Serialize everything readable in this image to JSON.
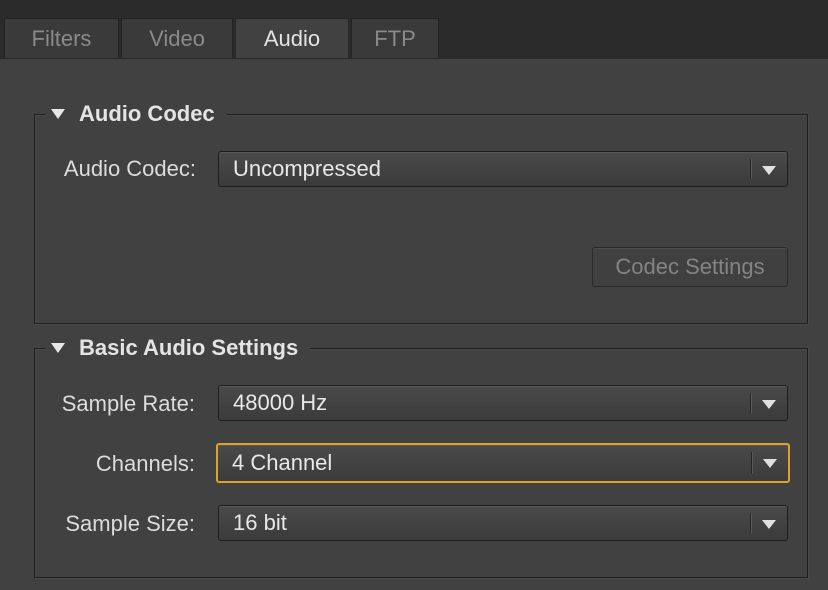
{
  "tabs": [
    {
      "label": "Filters",
      "active": false
    },
    {
      "label": "Video",
      "active": false
    },
    {
      "label": "Audio",
      "active": true
    },
    {
      "label": "FTP",
      "active": false
    }
  ],
  "audio_codec_group": {
    "title": "Audio Codec",
    "codec_label": "Audio Codec:",
    "codec_value": "Uncompressed",
    "codec_settings_button": "Codec Settings",
    "codec_settings_enabled": false
  },
  "basic_audio_group": {
    "title": "Basic Audio Settings",
    "sample_rate_label": "Sample Rate:",
    "sample_rate_value": "48000 Hz",
    "channels_label": "Channels:",
    "channels_value": "4 Channel",
    "sample_size_label": "Sample Size:",
    "sample_size_value": "16 bit"
  },
  "colors": {
    "focus_accent": "#e0a12a",
    "panel_bg": "#414141"
  }
}
